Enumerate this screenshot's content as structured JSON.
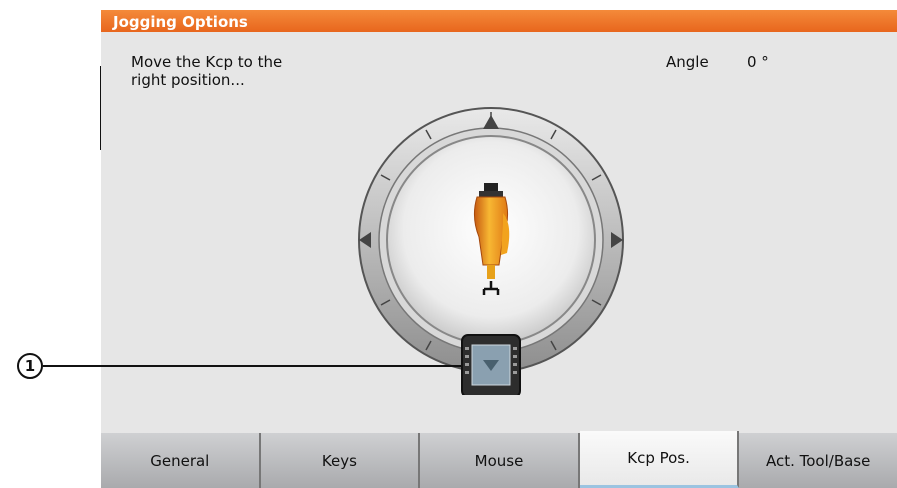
{
  "window": {
    "title": "Jogging Options"
  },
  "instruction": "Move the Kcp to the\nright position...",
  "angle": {
    "label": "Angle",
    "value": "0 °"
  },
  "tabs": [
    {
      "label": "General"
    },
    {
      "label": "Keys"
    },
    {
      "label": "Mouse"
    },
    {
      "label": "Kcp Pos.",
      "active": true
    },
    {
      "label": "Act. Tool/Base"
    }
  ],
  "callout": {
    "number": "1"
  },
  "colors": {
    "title_bar": "#e8661d",
    "robot": "#f5a623",
    "accent": "#9bc3e0"
  },
  "icons": [
    "kcp-dial-icon",
    "robot-arm-icon",
    "kcp-pendant-icon"
  ]
}
